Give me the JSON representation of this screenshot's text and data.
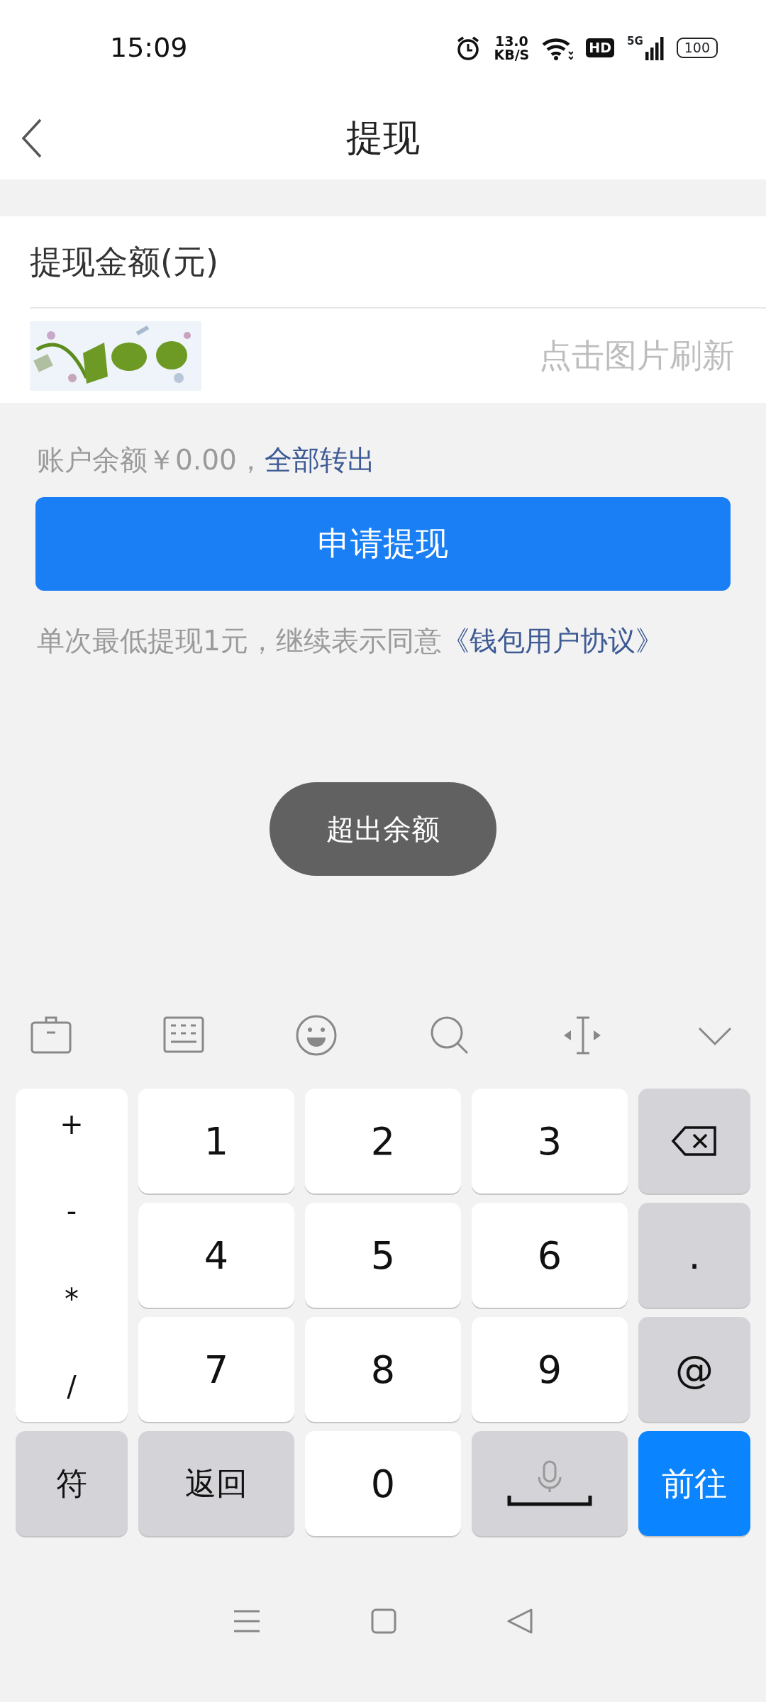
{
  "status_bar": {
    "time": "15:09",
    "net_speed": "13.0",
    "net_unit": "KB/S",
    "hd": "HD",
    "network": "5G",
    "battery": "100"
  },
  "header": {
    "title": "提现"
  },
  "form": {
    "amount_label": "提现金额(元)",
    "captcha_placeholder": "点击图片刷新"
  },
  "balance": {
    "text": "账户余额￥0.00，",
    "link": "全部转出"
  },
  "submit_button": "申请提现",
  "agreement": {
    "text": "单次最低提现1元，继续表示同意",
    "link": "《钱包用户协议》"
  },
  "toast": "超出余额",
  "keyboard": {
    "symbols": [
      "+",
      "-",
      "*",
      "/"
    ],
    "keys": [
      {
        "kind": "digit",
        "label": "1"
      },
      {
        "kind": "digit",
        "label": "2"
      },
      {
        "kind": "digit",
        "label": "3"
      },
      {
        "kind": "backspace"
      },
      {
        "kind": "digit",
        "label": "4"
      },
      {
        "kind": "digit",
        "label": "5"
      },
      {
        "kind": "digit",
        "label": "6"
      },
      {
        "kind": "func",
        "label": "."
      },
      {
        "kind": "digit",
        "label": "7"
      },
      {
        "kind": "digit",
        "label": "8"
      },
      {
        "kind": "digit",
        "label": "9"
      },
      {
        "kind": "func",
        "label": "@"
      },
      {
        "kind": "func",
        "label": "符"
      },
      {
        "kind": "func",
        "label": "返回"
      },
      {
        "kind": "digit",
        "label": "0"
      },
      {
        "kind": "space"
      },
      {
        "kind": "go",
        "label": "前往"
      }
    ]
  }
}
